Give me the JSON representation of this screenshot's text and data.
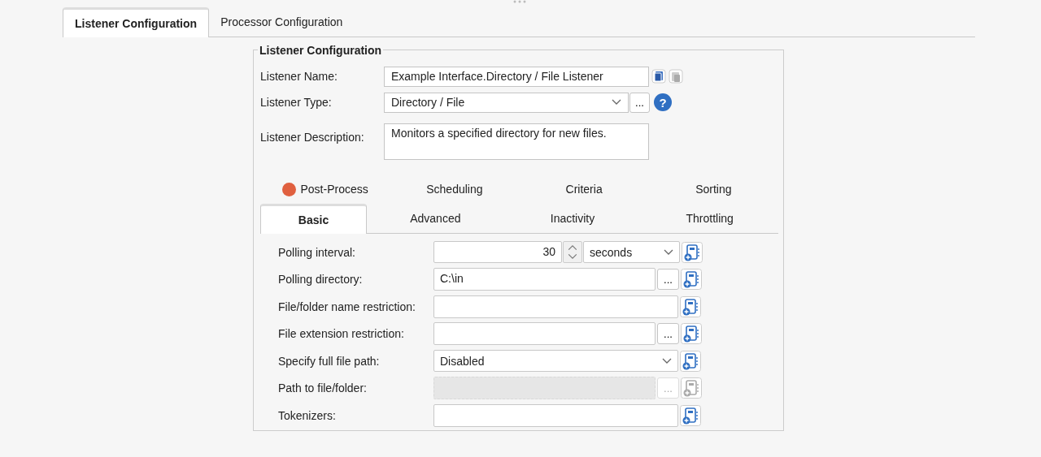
{
  "main_tabs": [
    {
      "label": "Listener Configuration",
      "selected": true
    },
    {
      "label": "Processor Configuration",
      "selected": false
    }
  ],
  "group": {
    "title": "Listener Configuration",
    "name": {
      "label": "Listener Name:",
      "value": "Example Interface.Directory / File Listener"
    },
    "type": {
      "label": "Listener Type:",
      "value": "Directory / File",
      "browse": "...",
      "help": "?"
    },
    "description": {
      "label": "Listener Description:",
      "value": "Monitors a specified directory for new files."
    }
  },
  "tab_rows": [
    [
      {
        "label": "Post-Process",
        "selected": false,
        "color": "#e0603f"
      },
      {
        "label": "Scheduling",
        "selected": false
      },
      {
        "label": "Criteria",
        "selected": false
      },
      {
        "label": "Sorting",
        "selected": false
      }
    ],
    [
      {
        "label": "Basic",
        "selected": true
      },
      {
        "label": "Advanced",
        "selected": false
      },
      {
        "label": "Inactivity",
        "selected": false
      },
      {
        "label": "Throttling",
        "selected": false
      }
    ]
  ],
  "fields": [
    {
      "kind": "number",
      "label": "Polling interval:",
      "value": "30",
      "unit": "seconds",
      "disabled": false
    },
    {
      "kind": "text",
      "label": "Polling directory:",
      "value": "C:\\in",
      "browse": "...",
      "disabled": false
    },
    {
      "kind": "text",
      "label": "File/folder name restriction:",
      "disabled": false
    },
    {
      "kind": "text",
      "label": "File extension restriction:",
      "browse": "...",
      "disabled": false
    },
    {
      "kind": "select",
      "label": "Specify full file path:",
      "value": "Disabled",
      "disabled": false
    },
    {
      "kind": "text",
      "label": "Path to file/folder:",
      "browse": "...",
      "disabled": true
    },
    {
      "kind": "text",
      "label": "Tokenizers:",
      "disabled": false
    }
  ]
}
